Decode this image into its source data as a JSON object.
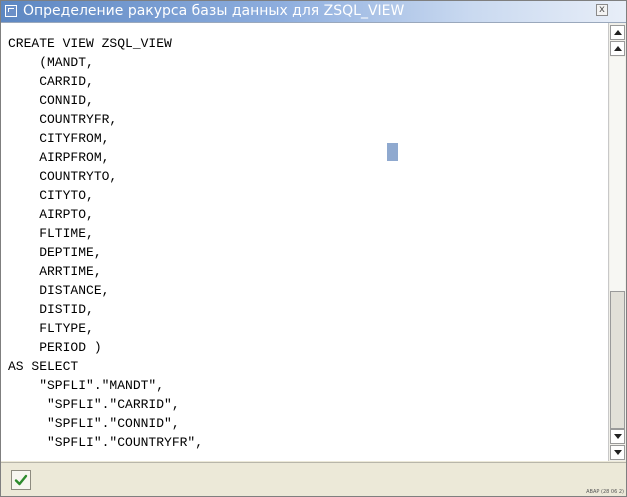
{
  "window": {
    "title": "Определение ракурса базы данных для  ZSQL_VIEW",
    "close_label": "x"
  },
  "editor": {
    "lines": [
      "CREATE VIEW ZSQL_VIEW",
      "    (MANDT,",
      "    CARRID,",
      "    CONNID,",
      "    COUNTRYFR,",
      "    CITYFROM,",
      "    AIRPFROM,",
      "    COUNTRYTO,",
      "    CITYTO,",
      "    AIRPTO,",
      "    FLTIME,",
      "    DEPTIME,",
      "    ARRTIME,",
      "    DISTANCE,",
      "    DISTID,",
      "    FLTYPE,",
      "    PERIOD )",
      "AS SELECT",
      "    \"SPFLI\".\"MANDT\",",
      "     \"SPFLI\".\"CARRID\",",
      "     \"SPFLI\".\"CONNID\",",
      "     \"SPFLI\".\"COUNTRYFR\","
    ]
  },
  "scrollbar": {
    "up_icon": "arrow-up-icon",
    "down_icon": "arrow-down-icon"
  },
  "footer": {
    "ok_icon": "checkmark-icon",
    "system_label": "ABAP (28 06 2)"
  },
  "colors": {
    "title_gradient_start": "#5d87c2",
    "cursor": "#8fa9cf",
    "ok_green": "#2e8b2e"
  }
}
